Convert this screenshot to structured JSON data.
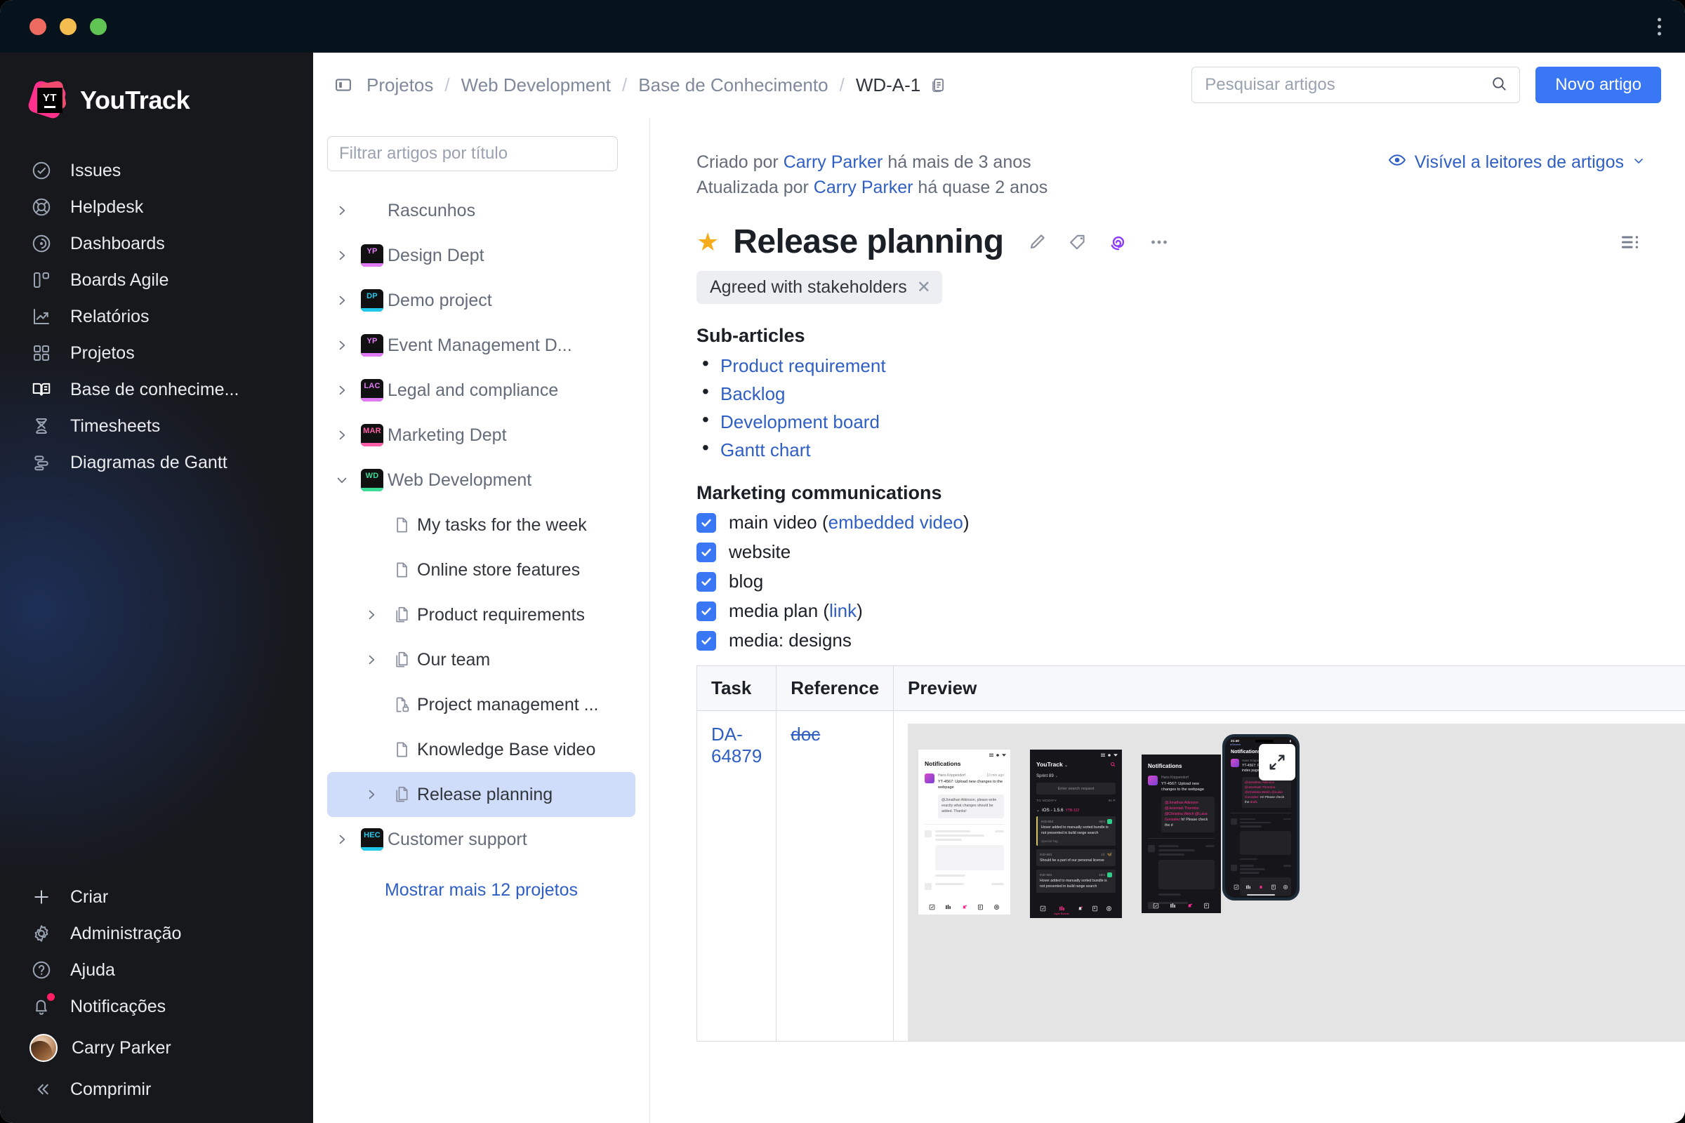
{
  "window": {
    "traffic_lights": [
      "close",
      "minimize",
      "maximize"
    ],
    "menu_icon": "kebab-menu-icon"
  },
  "sidebar": {
    "brand": "YouTrack",
    "items": [
      {
        "label": "Issues",
        "icon": "check-circle-icon"
      },
      {
        "label": "Helpdesk",
        "icon": "lifebuoy-icon"
      },
      {
        "label": "Dashboards",
        "icon": "radar-icon"
      },
      {
        "label": "Boards Agile",
        "icon": "board-columns-icon"
      },
      {
        "label": "Relatórios",
        "icon": "chart-line-icon"
      },
      {
        "label": "Projetos",
        "icon": "grid-squares-icon"
      },
      {
        "label": "Base de conhecime...",
        "icon": "open-book-icon"
      },
      {
        "label": "Timesheets",
        "icon": "hourglass-icon"
      },
      {
        "label": "Diagramas de Gantt",
        "icon": "gantt-icon"
      }
    ],
    "bottom_items": [
      {
        "label": "Criar",
        "icon": "plus-icon"
      },
      {
        "label": "Administração",
        "icon": "gear-icon"
      },
      {
        "label": "Ajuda",
        "icon": "question-circle-icon"
      },
      {
        "label": "Notificações",
        "icon": "bell-icon",
        "badge": true
      }
    ],
    "user": {
      "name": "Carry Parker",
      "icon": "avatar"
    },
    "collapse": {
      "label": "Comprimir",
      "icon": "chevrons-left-icon"
    }
  },
  "header": {
    "panel_toggle_icon": "panel-toggle-icon",
    "breadcrumb": [
      "Projetos",
      "Web Development",
      "Base de Conhecimento"
    ],
    "article_id": "WD-A-1",
    "article_id_icon": "copy-article-icon",
    "separator": "/",
    "search": {
      "placeholder": "Pesquisar artigos",
      "value": "",
      "icon": "search-icon"
    },
    "new_article_label": "Novo artigo"
  },
  "tree": {
    "filter_placeholder": "Filtrar artigos por título",
    "rows": [
      {
        "label": "Rascunhos",
        "chevron": "right",
        "icon": null,
        "indent": 0,
        "muted": true
      },
      {
        "label": "Design Dept",
        "chevron": "right",
        "icon": "project",
        "abbr": "YP",
        "color": "#e07bf5",
        "indent": 0,
        "muted": true
      },
      {
        "label": "Demo project",
        "chevron": "right",
        "icon": "project",
        "abbr": "DP",
        "color": "#22c9ea",
        "indent": 0,
        "muted": true
      },
      {
        "label": "Event Management D...",
        "chevron": "right",
        "icon": "project",
        "abbr": "YP",
        "color": "#e07bf5",
        "indent": 0,
        "muted": true
      },
      {
        "label": "Legal and compliance",
        "chevron": "right",
        "icon": "project",
        "abbr": "LAC",
        "color": "#e07bf5",
        "indent": 0,
        "muted": true
      },
      {
        "label": "Marketing Dept",
        "chevron": "right",
        "icon": "project",
        "abbr": "MAR",
        "color": "#ff5fa8",
        "indent": 0,
        "muted": true
      },
      {
        "label": "Web Development",
        "chevron": "down",
        "icon": "project",
        "abbr": "WD",
        "color": "#3ddc97",
        "indent": 0,
        "muted": true
      },
      {
        "label": "My tasks for the week",
        "chevron": null,
        "icon": "doc",
        "indent": 1,
        "muted": false
      },
      {
        "label": "Online store features",
        "chevron": null,
        "icon": "doc",
        "indent": 1,
        "muted": false
      },
      {
        "label": "Product requirements",
        "chevron": "right",
        "icon": "docs",
        "indent": 1,
        "muted": false
      },
      {
        "label": "Our team",
        "chevron": "right",
        "icon": "docs",
        "indent": 1,
        "muted": false
      },
      {
        "label": "Project management ...",
        "chevron": null,
        "icon": "doc-lock",
        "indent": 1,
        "muted": false
      },
      {
        "label": "Knowledge Base video",
        "chevron": null,
        "icon": "doc",
        "indent": 1,
        "muted": false
      },
      {
        "label": "Release planning",
        "chevron": "right",
        "icon": "docs",
        "indent": 1,
        "muted": false,
        "selected": true
      },
      {
        "label": "Customer support",
        "chevron": "right",
        "icon": "project",
        "abbr": "HEC",
        "color": "#22c9ea",
        "indent": 0,
        "muted": true
      }
    ],
    "show_more": "Mostrar mais 12 projetos"
  },
  "article": {
    "created_prefix": "Criado por",
    "created_author": "Carry Parker",
    "created_suffix": "há mais de 3 anos",
    "updated_prefix": "Atualizada por",
    "updated_author": "Carry Parker",
    "updated_suffix": "há quase 2 anos",
    "visibility": {
      "label": "Visível a leitores de artigos",
      "eye_icon": "eye-icon",
      "chevron": "chevron-down-icon"
    },
    "star_icon": "star-filled-icon",
    "title": "Release planning",
    "actions": [
      {
        "name": "edit-article",
        "icon": "pencil-icon"
      },
      {
        "name": "add-tag",
        "icon": "tag-icon"
      },
      {
        "name": "ai-assistant",
        "icon": "ai-spiral-icon",
        "color": "#8b3dff"
      },
      {
        "name": "more-actions",
        "icon": "ellipsis-icon"
      }
    ],
    "toc_icon": "table-of-contents-icon",
    "tag": {
      "label": "Agreed with stakeholders",
      "remove_icon": "close-icon"
    },
    "sub_articles_heading": "Sub-articles",
    "sub_articles": [
      "Product requirement",
      "Backlog",
      "Development board",
      "Gantt chart"
    ],
    "marketing_heading": "Marketing communications",
    "checklist": [
      {
        "checked": true,
        "text": "main video (",
        "link": "embedded video",
        "tail": ")"
      },
      {
        "checked": true,
        "text": "website",
        "link": null,
        "tail": ""
      },
      {
        "checked": true,
        "text": "blog",
        "link": null,
        "tail": ""
      },
      {
        "checked": true,
        "text": "media plan (",
        "link": "link",
        "tail": ")"
      },
      {
        "checked": true,
        "text": "media: designs",
        "link": null,
        "tail": ""
      }
    ],
    "table": {
      "columns": [
        "Task",
        "Reference",
        "Preview"
      ],
      "rows": [
        {
          "task": "DA-64879",
          "reference": "doc",
          "preview": "mobile-mockups-image"
        }
      ]
    },
    "preview": {
      "expand_icon": "expand-icon",
      "phones": [
        {
          "theme": "light",
          "title": "Notifications",
          "author": "Hans Krippendorf",
          "time": "10 min ago",
          "subject": "YT-4567: Upload new changes to the webpage",
          "body": "@Jonathan Atkinson, please write exactly what changes should be added. Thanks!"
        },
        {
          "theme": "dark",
          "app": "YouTrack",
          "sprint": "Sprint 89",
          "search_placeholder": "Enter search request",
          "col_left": "TO MODIFY",
          "col_right": "IN P",
          "swimlane": "iOS - 1.5.6",
          "swimlane_tag": "YTB-122",
          "cards": [
            {
              "id": "IND-583",
              "age": "30m",
              "text": "Hover added to manually sorted bundle is not presented in build range search",
              "tag": "Special Tag"
            },
            {
              "id": "IND-583",
              "age": "1h",
              "text": "Should be a part of our personal license"
            },
            {
              "id": "IND-583",
              "age": "45m",
              "text": "Hover added to manually sorted bundle is not presented in build range search"
            }
          ],
          "tabbar_active": "Agile Boards"
        },
        {
          "theme": "dark",
          "title": "Notifications",
          "author": "Hans Krippendorf",
          "subject": "YT-4567: Upload new changes to the webpage",
          "body": "@Jonathan Atkinson @Jeremiah Thornton @Christina Welch @Luisa Gonzalez hi! Please check the d"
        },
        {
          "theme": "dark-device",
          "status_time": "21:40",
          "back_label": "Search",
          "title": "Notifications",
          "author": "Hans Krippendorf",
          "subject": "YT-4567: Publish updated index page",
          "body": "@Jonathan Atkinson @Jeremiah Thornton @Christina Welch @Luisa Gonzalez: Hi! Please check the draft."
        }
      ]
    }
  },
  "colors": {
    "accent_blue": "#3977f4",
    "link_blue": "#2f5fc4",
    "sidebar_bg": "#17181c",
    "sidebar_glow": "#1d2f56",
    "selected_row": "#cfdcfa",
    "star_gold": "#f5ab1a",
    "ai_purple": "#8b3dff",
    "badge_red": "#ff1f62",
    "pink_accent": "#ff318c"
  }
}
